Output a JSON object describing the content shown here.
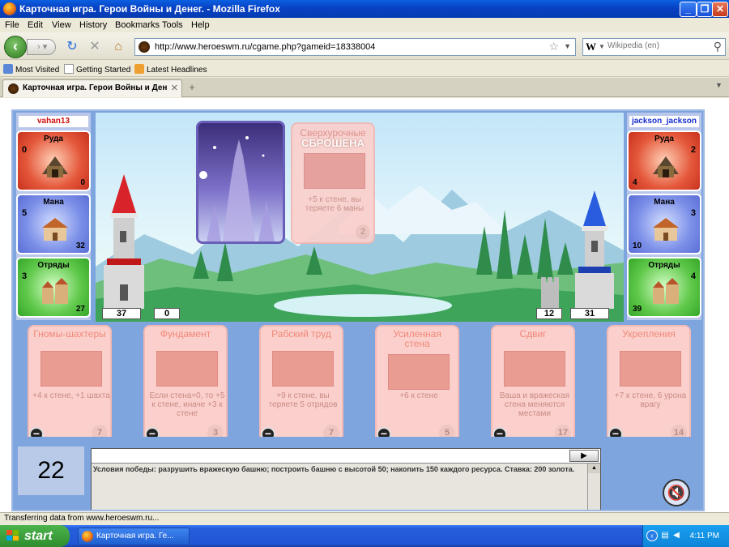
{
  "window": {
    "title": "Карточная игра. Герои Войны и Денег. - Mozilla Firefox",
    "buttons": {
      "minimize": "_",
      "maximize": "❐",
      "close": "✕"
    }
  },
  "menu": [
    "File",
    "Edit",
    "View",
    "History",
    "Bookmarks",
    "Tools",
    "Help"
  ],
  "nav": {
    "url": "http://www.heroeswm.ru/cgame.php?gameid=18338004",
    "search_engine": "W",
    "search_placeholder": "Wikipedia (en)"
  },
  "bookmarks": [
    "Most Visited",
    "Getting Started",
    "Latest Headlines"
  ],
  "tabs": [
    {
      "label": "Карточная игра. Герои Войны и Ден..."
    }
  ],
  "game": {
    "player_left": {
      "name": "vahan13",
      "name_color": "#d01010",
      "ore": {
        "label": "Руда",
        "production": "0",
        "amount": "0"
      },
      "mana": {
        "label": "Мана",
        "production": "5",
        "amount": "32"
      },
      "troops": {
        "label": "Отряды",
        "production": "3",
        "amount": "27"
      },
      "tower": "37",
      "wall": "0"
    },
    "player_right": {
      "name": "jackson_jackson",
      "name_color": "#1a2fd0",
      "ore": {
        "label": "Руда",
        "production": "2",
        "amount": "4"
      },
      "mana": {
        "label": "Мана",
        "production": "3",
        "amount": "10"
      },
      "troops": {
        "label": "Отряды",
        "production": "4",
        "amount": "39"
      },
      "wall": "12",
      "tower": "31"
    },
    "played_card": {
      "name": "Сверхурочные",
      "status": "СБРОШЕНА",
      "description": "+5 к стене, вы теряете 6 маны",
      "cost": "2"
    },
    "hand": [
      {
        "name": "Гномы-шахтеры",
        "description": "+4 к стене, +1 шахта",
        "cost": "7"
      },
      {
        "name": "Фундамент",
        "description": "Если стена=0, то +5 к стене, иначе +3 к стене",
        "cost": "3"
      },
      {
        "name": "Рабский труд",
        "description": "+9 к стене, вы теряете 5 отрядов",
        "cost": "7"
      },
      {
        "name": "Усиленная стена",
        "description": "+6 к стене",
        "cost": "5"
      },
      {
        "name": "Сдвиг",
        "description": "Ваша и вражеская стена меняются местами",
        "cost": "17"
      },
      {
        "name": "Укрепления",
        "description": "+7 к стене, 6 урона врагу",
        "cost": "14"
      }
    ],
    "discard_symbol": "−",
    "timer": "22",
    "chat": {
      "message": "Условия победы: разрушить вражескую башню; построить башню с высотой 50; накопить 150 каждого ресурса. Ставка: 200 золота."
    }
  },
  "status": "Transferring data from www.heroeswm.ru...",
  "taskbar": {
    "start": "start",
    "window": "Карточная игра. Ге...",
    "clock": "4:11 PM"
  }
}
